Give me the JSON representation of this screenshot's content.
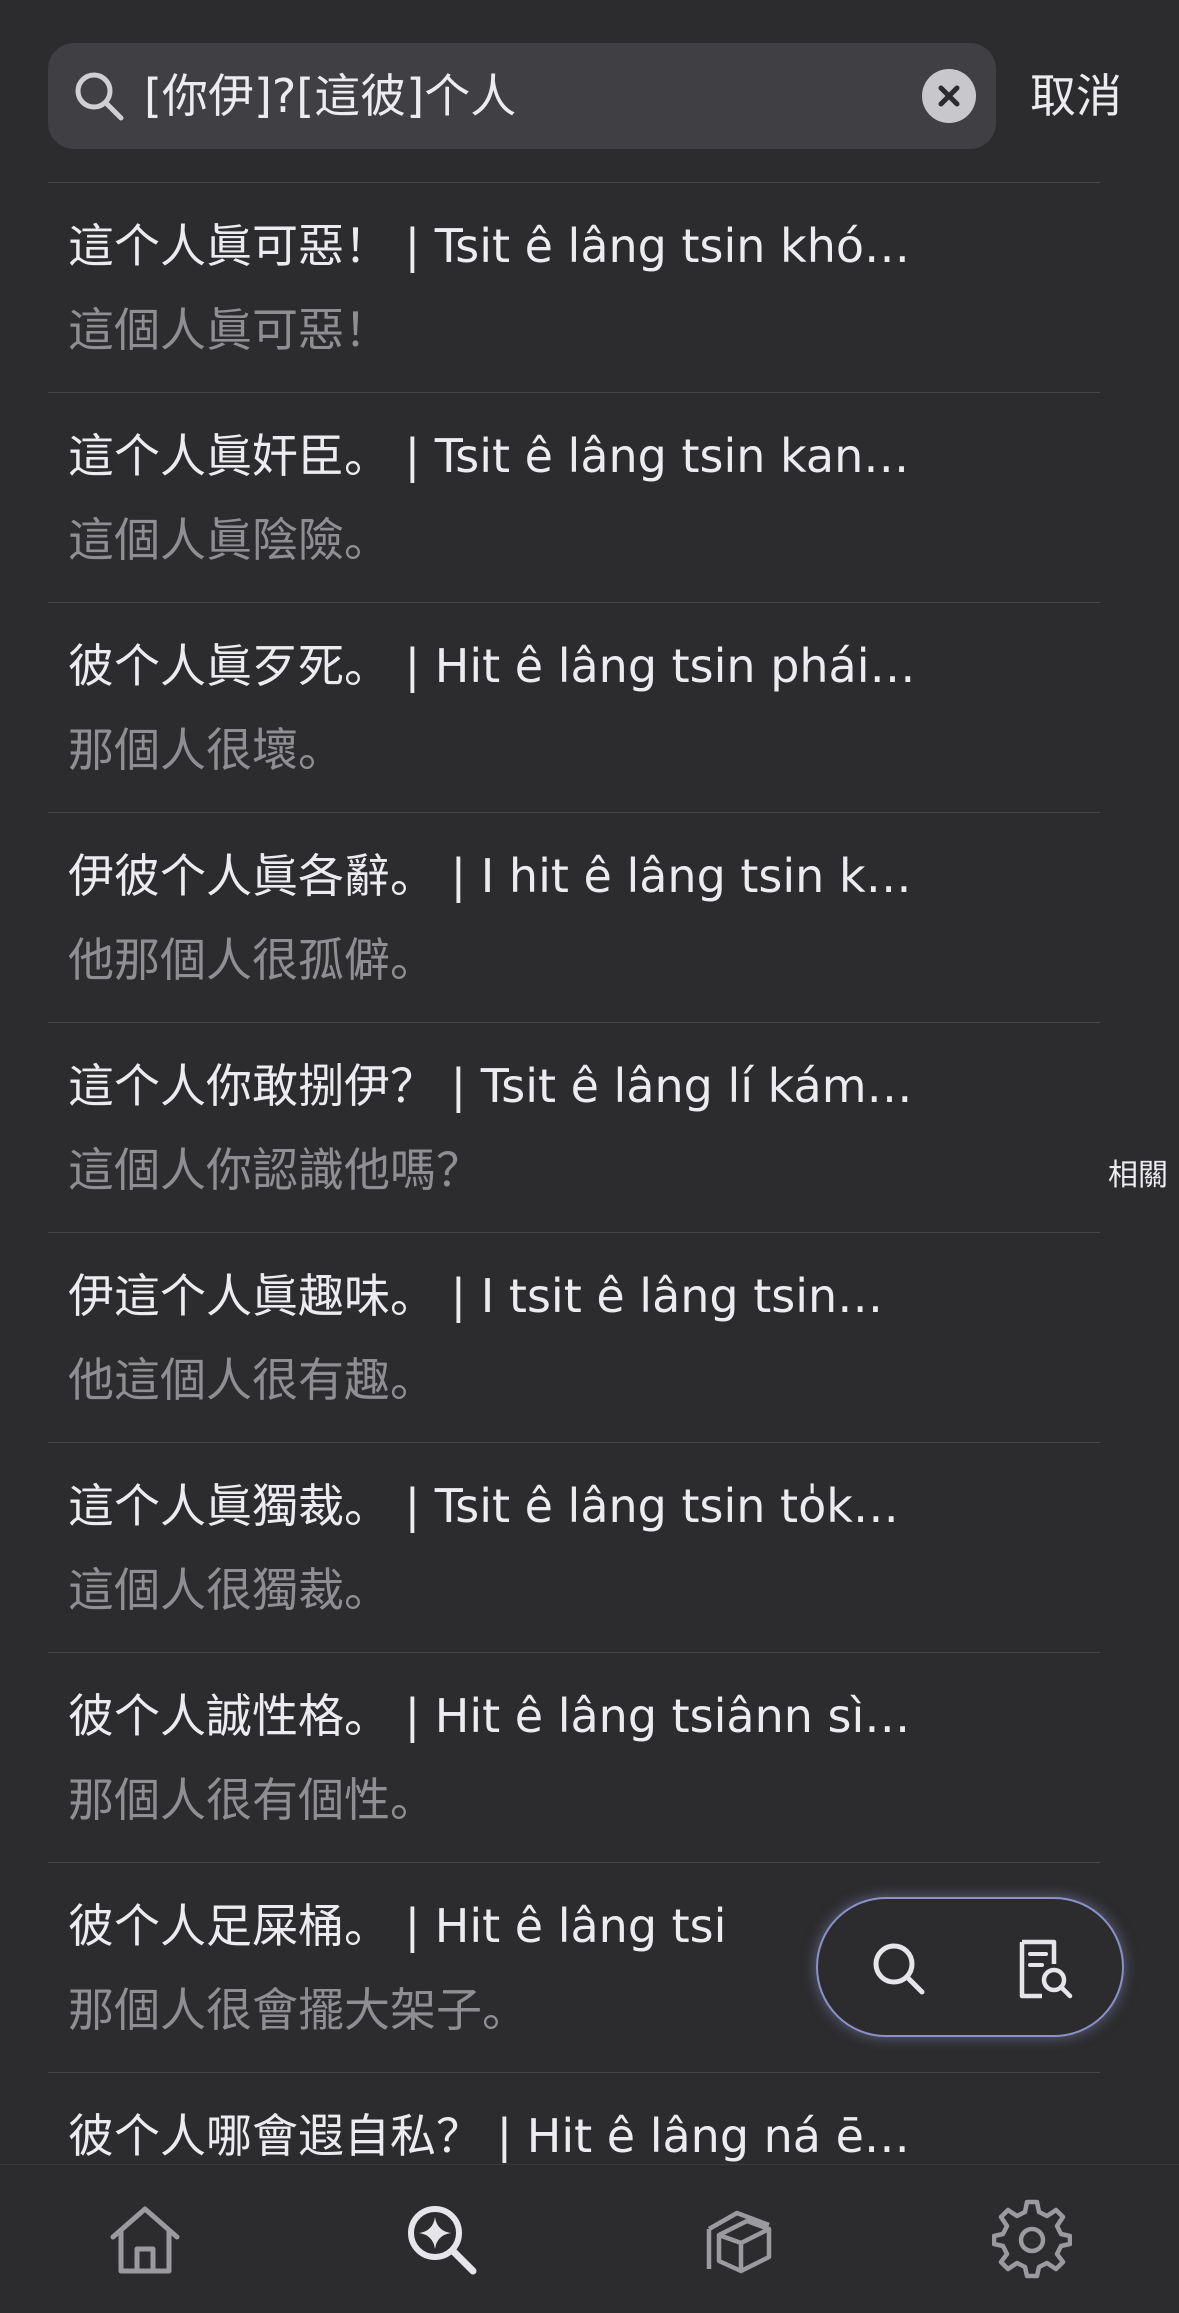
{
  "search": {
    "query": "[你伊]?[這彼]个人",
    "cancel_label": "取消"
  },
  "results": [
    {
      "main": "這个人眞可惡！ | Tsit ê lâng tsin khó…",
      "sub": "這個人眞可惡！"
    },
    {
      "main": "這个人眞奸臣。 | Tsit ê lâng tsin kan…",
      "sub": "這個人眞陰險。"
    },
    {
      "main": "彼个人眞歹死。 | Hit ê lâng tsin phái…",
      "sub": "那個人很壞。"
    },
    {
      "main": "伊彼个人眞各辭。 | I hit ê lâng tsin k…",
      "sub": "他那個人很孤僻。"
    },
    {
      "main": "這个人你敢捌伊？ | Tsit ê lâng lí kám…",
      "sub": "這個人你認識他嗎？"
    },
    {
      "main": "伊這个人眞趣味。 | I tsit ê lâng tsin…",
      "sub": "他這個人很有趣。"
    },
    {
      "main": "這个人眞獨裁。 | Tsit ê lâng tsin to̍k…",
      "sub": "這個人很獨裁。"
    },
    {
      "main": "彼个人誠性格。 | Hit ê lâng tsiânn sì…",
      "sub": "那個人很有個性。"
    },
    {
      "main": "彼个人足屎桶。 | Hit ê lâng tsi",
      "sub": "那個人很會擺大架子。"
    },
    {
      "main": "彼个人哪會遐自私？ | Hit ê lâng ná ē…",
      "sub": ""
    }
  ],
  "related_label": "相關",
  "icons": {
    "search": "search-icon",
    "clear": "clear-icon",
    "fab_search": "search-icon",
    "fab_doc": "document-search-icon",
    "home": "home-icon",
    "explore": "search-sparkle-icon",
    "library": "library-icon",
    "settings": "gear-icon"
  },
  "colors": {
    "background": "#2c2c2e",
    "search_field": "#3f3f44",
    "text_primary": "#ececf0",
    "text_secondary": "#8e8e93",
    "fab_border": "#8b90c8"
  }
}
